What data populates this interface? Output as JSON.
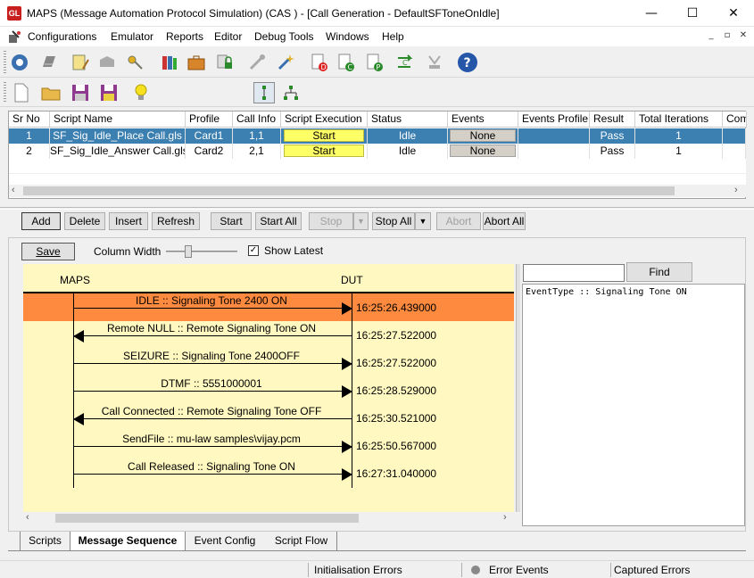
{
  "window": {
    "title": "MAPS (Message Automation Protocol Simulation)  (CAS ) - [Call Generation  - DefaultSFToneOnIdle]",
    "logo_text": "GL",
    "minimize": "—",
    "maximize": "☐",
    "close": "✕"
  },
  "menu": {
    "items": [
      "Configurations",
      "Emulator",
      "Reports",
      "Editor",
      "Debug Tools",
      "Windows",
      "Help"
    ],
    "mdi_min": "_",
    "mdi_restore": "▫",
    "mdi_close": "✕"
  },
  "grid": {
    "columns": [
      "Sr No",
      "Script Name",
      "Profile",
      "Call Info",
      "Script Execution",
      "Status",
      "Events",
      "Events Profile",
      "Result",
      "Total Iterations",
      "Comp"
    ],
    "rows": [
      {
        "sr": "1",
        "script": "SF_Sig_Idle_Place Call.gls",
        "profile": "Card1",
        "callinfo": "1,1",
        "exec": "Start",
        "status": "Idle",
        "events": "None",
        "events_profile": "",
        "result": "Pass",
        "iterations": "1"
      },
      {
        "sr": "2",
        "script": "SF_Sig_Idle_Answer Call.gls",
        "profile": "Card2",
        "callinfo": "2,1",
        "exec": "Start",
        "status": "Idle",
        "events": "None",
        "events_profile": "",
        "result": "Pass",
        "iterations": "1"
      }
    ]
  },
  "buttons": {
    "add": "Add",
    "delete": "Delete",
    "insert": "Insert",
    "refresh": "Refresh",
    "start": "Start",
    "start_all": "Start All",
    "stop": "Stop",
    "stop_all": "Stop All",
    "abort": "Abort",
    "abort_all": "Abort All"
  },
  "seq_toolbar": {
    "save": "Save",
    "column_width": "Column Width",
    "show_latest": "Show Latest",
    "show_latest_checked": true
  },
  "sequence": {
    "left_entity": "MAPS",
    "right_entity": "DUT",
    "events": [
      {
        "label": "IDLE :: Signaling Tone 2400 ON",
        "time": "16:25:26.439000",
        "dir": "right",
        "highlight": true
      },
      {
        "label": "Remote NULL :: Remote Signaling Tone ON",
        "time": "16:25:27.522000",
        "dir": "left",
        "highlight": false
      },
      {
        "label": "SEIZURE :: Signaling Tone 2400OFF",
        "time": "16:25:27.522000",
        "dir": "right",
        "highlight": false
      },
      {
        "label": "DTMF :: 5551000001",
        "time": "16:25:28.529000",
        "dir": "right",
        "highlight": false
      },
      {
        "label": "Call Connected :: Remote Signaling Tone OFF",
        "time": "16:25:30.521000",
        "dir": "left",
        "highlight": false
      },
      {
        "label": "SendFile  :: mu-law samples\\vijay.pcm",
        "time": "16:25:50.567000",
        "dir": "right",
        "highlight": false
      },
      {
        "label": "Call Released :: Signaling Tone ON",
        "time": "16:27:31.040000",
        "dir": "right",
        "highlight": false
      }
    ],
    "highlight_color": "#fd8a3e",
    "background_color": "#fff8c0"
  },
  "find": {
    "input_value": "",
    "button": "Find",
    "detail_text": "EventType :: Signaling Tone ON"
  },
  "tabs": [
    "Scripts",
    "Message Sequence",
    "Event Config",
    "Script Flow"
  ],
  "active_tab": "Message Sequence",
  "status_bar": {
    "init_errors": "Initialisation Errors",
    "error_events": "Error Events",
    "captured_errors": "Captured Errors"
  }
}
